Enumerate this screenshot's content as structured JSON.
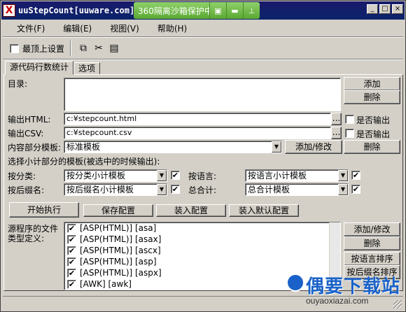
{
  "window": {
    "title": "uuStepCount[uuware.com]",
    "app_icon": "X",
    "controls": [
      "_",
      "□",
      "×"
    ]
  },
  "sandbox": {
    "text": "360隔离沙箱保护中...",
    "icons": [
      "restore-icon",
      "folder-icon",
      "pin-icon"
    ]
  },
  "menu": {
    "items": [
      "文件(F)",
      "编辑(E)",
      "视图(V)",
      "帮助(H)"
    ]
  },
  "toolbar": {
    "topmost_label": "最顶上设置",
    "topmost_checked": false,
    "icons": [
      "copy-icon",
      "cut-icon",
      "paste-icon"
    ]
  },
  "tabs": [
    {
      "label": "源代码行数统计",
      "active": true
    },
    {
      "label": "选项",
      "active": false
    }
  ],
  "form": {
    "dir_label": "目录:",
    "add_button": "添加",
    "delete_button": "删除",
    "html_label": "输出HTML:",
    "html_value": "c:¥stepcount.html",
    "csv_label": "输出CSV:",
    "csv_value": "c:¥stepcount.csv",
    "browse": "...",
    "output_label": "是否输出",
    "template_label": "内容部分模板:",
    "template_value": "标准模板",
    "add_edit_button": "添加/修改",
    "template_delete_button": "删除",
    "subtotal_label": "选择小计部分的模板(被选中的时候输出):",
    "by_category_label": "按分类:",
    "by_category_value": "按分类小计模板",
    "by_language_label": "按语言:",
    "by_language_value": "按语言小计模板",
    "by_ext_label": "按后缀名:",
    "by_ext_value": "按后缀名小计模板",
    "total_label": "总合计:",
    "total_value": "总合计模板",
    "start_button": "开始执行",
    "save_button": "保存配置",
    "load_button": "装入配置",
    "load_default_button": "装入默认配置",
    "source_def_label": "源程序的文件类型定义:",
    "def_add_edit_button": "添加/修改",
    "def_delete_button": "删除",
    "sort_language_button": "按语言排序",
    "sort_ext_button": "按后缀名排序"
  },
  "file_types": [
    "[ASP(HTML)] [asa]",
    "[ASP(HTML)] [asax]",
    "[ASP(HTML)] [ascx]",
    "[ASP(HTML)] [asp]",
    "[ASP(HTML)] [aspx]",
    "[AWK] [awk]"
  ],
  "watermark": {
    "line1": "偶要下载站",
    "line2": "ouyaoxiazai.com"
  }
}
